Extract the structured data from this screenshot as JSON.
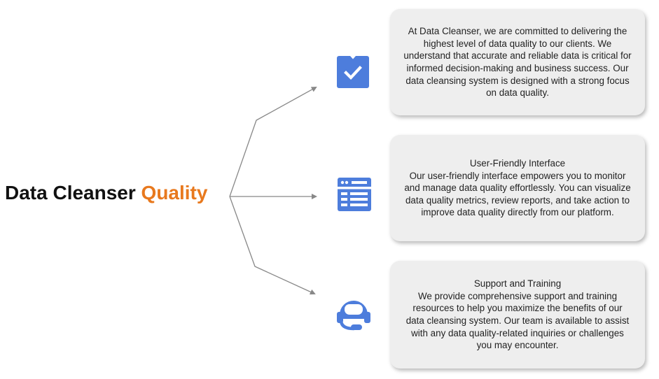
{
  "title": {
    "main": "Data Cleanser ",
    "accent": "Quality",
    "accent_color": "#e8791e"
  },
  "colors": {
    "icon_blue": "#4d7ddc",
    "card_bg": "#eeeeee",
    "connector": "#888888"
  },
  "branches": [
    {
      "icon": "checklist-icon",
      "heading": "",
      "body": "At Data Cleanser, we are committed to delivering the highest level of data quality to our clients. We understand that accurate and reliable data is critical for informed decision-making and business success. Our data cleansing system is designed with a strong focus on data quality."
    },
    {
      "icon": "browser-window-icon",
      "heading": "User-Friendly Interface",
      "body": "Our user-friendly interface empowers you to monitor and manage data quality effortlessly. You can visualize data quality metrics, review reports, and take action to improve data quality directly from our platform."
    },
    {
      "icon": "support-headset-icon",
      "heading": "Support and Training",
      "body": "We provide comprehensive support and training resources to help you maximize the benefits of our data cleansing system. Our team is available to assist with any data quality-related inquiries or challenges you may encounter."
    }
  ]
}
